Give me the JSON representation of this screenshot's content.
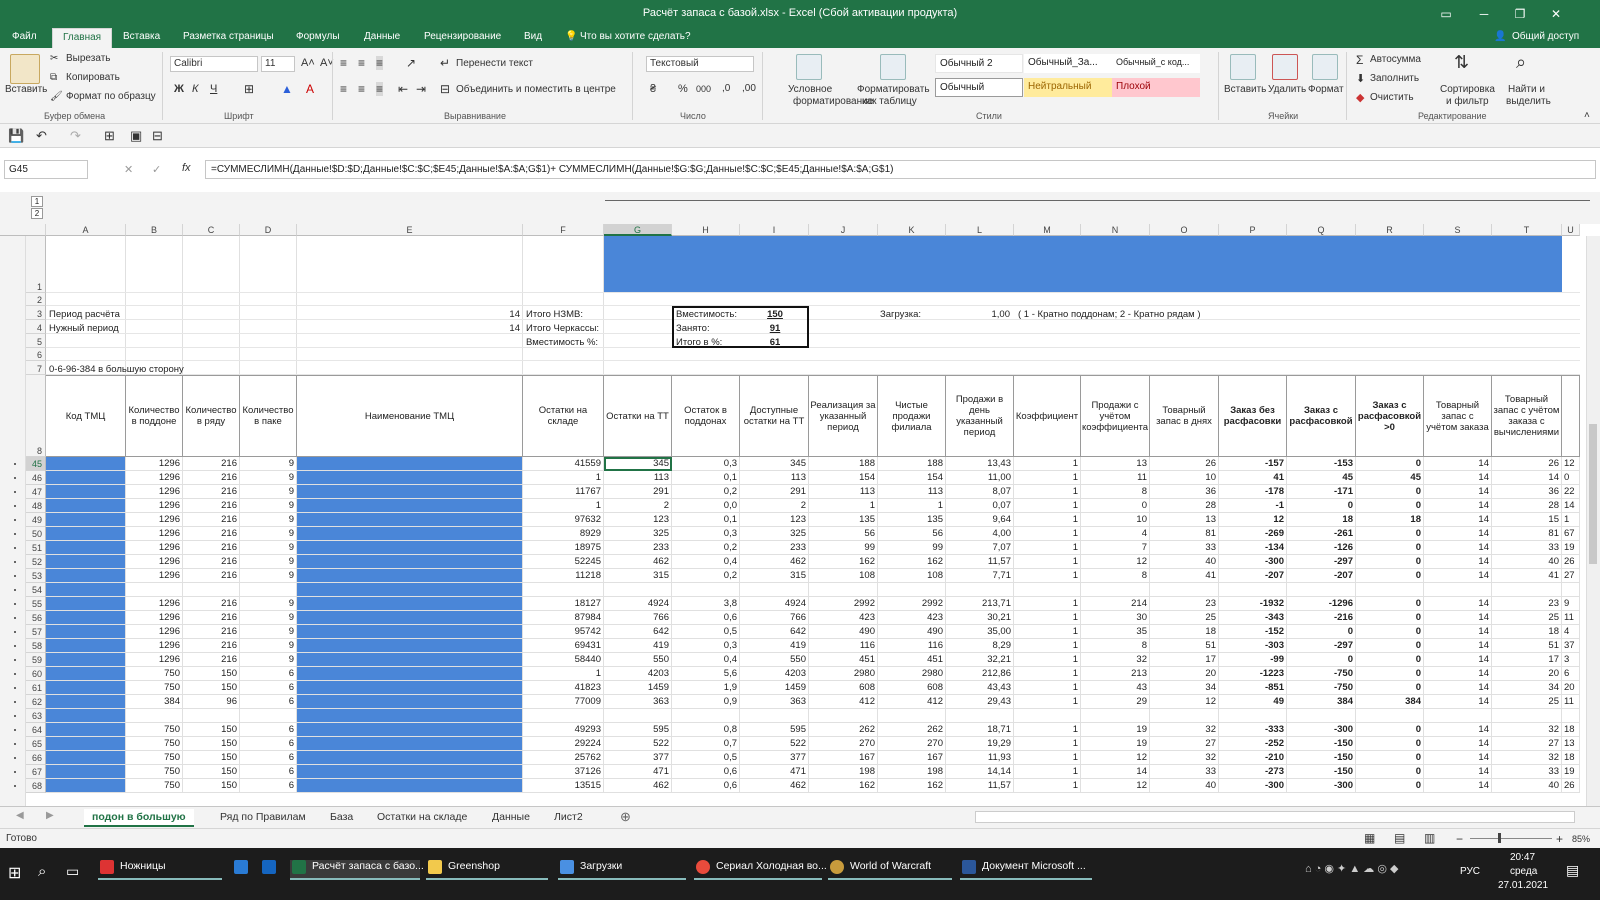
{
  "app": {
    "title": "Расчёт запаса с базой.xlsx - Excel (Сбой активации продукта)",
    "accent": "#217346"
  },
  "ribbon_tabs": [
    "Файл",
    "Главная",
    "Вставка",
    "Разметка страницы",
    "Формулы",
    "Данные",
    "Рецензирование",
    "Вид"
  ],
  "tellme": "Что вы хотите сделать?",
  "share": "Общий доступ",
  "ribbon": {
    "paste": "Вставить",
    "cut": "Вырезать",
    "copy": "Копировать",
    "format_painter": "Формат по образцу",
    "clipboard_group": "Буфер обмена",
    "font_name": "Calibri",
    "font_size": "11",
    "font_group": "Шрифт",
    "bold": "Ж",
    "italic": "К",
    "underline": "Ч",
    "wrap": "Перенести текст",
    "merge": "Объединить и поместить в центре",
    "align_group": "Выравнивание",
    "number_format": "Текстовый",
    "number_group": "Число",
    "percent": "%",
    "thousands": "000",
    "cond_format_1": "Условное",
    "cond_format_2": "форматирование",
    "format_table_1": "Форматировать",
    "format_table_2": "как таблицу",
    "styles": [
      "Обычный 2",
      "Обычный_За...",
      "Обычный_с код...",
      "Обычный",
      "Нейтральный",
      "Плохой"
    ],
    "styles_group": "Стили",
    "insert": "Вставить",
    "delete": "Удалить",
    "format": "Формат",
    "cells_group": "Ячейки",
    "autosum": "Автосумма",
    "fill": "Заполнить",
    "clear": "Очистить",
    "sort_1": "Сортировка",
    "sort_2": "и фильтр",
    "find_1": "Найти и",
    "find_2": "выделить",
    "edit_group": "Редактирование"
  },
  "formula_bar": {
    "name_box": "G45",
    "fx": "fx",
    "formula": "=СУММЕСЛИМН(Данные!$D:$D;Данные!$C:$C;$E45;Данные!$A:$A;G$1)+ СУММЕСЛИМН(Данные!$G:$G;Данные!$C:$C;$E45;Данные!$A:$A;G$1)"
  },
  "outline_levels": [
    "1",
    "2"
  ],
  "columns": [
    "A",
    "B",
    "C",
    "D",
    "E",
    "F",
    "G",
    "H",
    "I",
    "J",
    "K",
    "L",
    "M",
    "N",
    "O",
    "P",
    "Q",
    "R",
    "S",
    "T",
    "U"
  ],
  "top_rows": {
    "r3_label": "Период расчёта",
    "r3_val": "14",
    "r3_f": "Итого НЗМВ:",
    "r4_label": "Нужный период",
    "r4_val": "14",
    "r4_f": "Итого Черкассы:",
    "r5_f": "Вместимость %:",
    "r7_label": "0-6-96-384 в большую сторону",
    "box_cap_label": "Вместимость:",
    "box_cap_val": "150",
    "box_busy_label": "Занято:",
    "box_busy_val": "91",
    "box_pct_label": "Итого в %:",
    "box_pct_val": "61",
    "load_label": "Загрузка:",
    "load_val": "1,00",
    "load_note": "( 1 - Кратно поддонам; 2 - Кратно рядам )"
  },
  "table_headers": {
    "A": "Код ТМЦ",
    "B": "Количество в поддоне",
    "C": "Количество в ряду",
    "D": "Количество в паке",
    "E": "Наименование ТМЦ",
    "F": "Остатки на складе",
    "G": "Остатки на ТТ",
    "H": "Остаток в поддонах",
    "I": "Доступные остатки на ТТ",
    "J": "Реализация за указанный период",
    "K": "Чистые продажи филиала",
    "L": "Продажи в день указанный период",
    "M": "Коэффициент",
    "N": "Продажи с учётом коэффициента",
    "O": "Товарный запас в днях",
    "P": "Заказ без расфасовки",
    "Q": "Заказ с расфасовкой",
    "R": "Заказ с расфасовкой >0",
    "S": "Товарный запас с учётом заказа",
    "T": "Товарный запас с учётом заказа с вычислениями"
  },
  "data_rows": [
    {
      "n": "45",
      "B": "1296",
      "C": "216",
      "D": "9",
      "F": "41559",
      "G": "345",
      "H": "0,3",
      "I": "345",
      "J": "188",
      "K": "188",
      "L": "13,43",
      "M": "1",
      "N": "13",
      "O": "26",
      "P": "-157",
      "Q": "-153",
      "R": "0",
      "S": "14",
      "T": "26",
      "U": "12"
    },
    {
      "n": "46",
      "B": "1296",
      "C": "216",
      "D": "9",
      "F": "1",
      "G": "113",
      "H": "0,1",
      "I": "113",
      "J": "154",
      "K": "154",
      "L": "11,00",
      "M": "1",
      "N": "11",
      "O": "10",
      "P": "41",
      "Q": "45",
      "R": "45",
      "S": "14",
      "T": "14",
      "U": "0"
    },
    {
      "n": "47",
      "B": "1296",
      "C": "216",
      "D": "9",
      "F": "11767",
      "G": "291",
      "H": "0,2",
      "I": "291",
      "J": "113",
      "K": "113",
      "L": "8,07",
      "M": "1",
      "N": "8",
      "O": "36",
      "P": "-178",
      "Q": "-171",
      "R": "0",
      "S": "14",
      "T": "36",
      "U": "22"
    },
    {
      "n": "48",
      "B": "1296",
      "C": "216",
      "D": "9",
      "F": "1",
      "G": "2",
      "H": "0,0",
      "I": "2",
      "J": "1",
      "K": "1",
      "L": "0,07",
      "M": "1",
      "N": "0",
      "O": "28",
      "P": "-1",
      "Q": "0",
      "R": "0",
      "S": "14",
      "T": "28",
      "U": "14"
    },
    {
      "n": "49",
      "B": "1296",
      "C": "216",
      "D": "9",
      "F": "97632",
      "G": "123",
      "H": "0,1",
      "I": "123",
      "J": "135",
      "K": "135",
      "L": "9,64",
      "M": "1",
      "N": "10",
      "O": "13",
      "P": "12",
      "Q": "18",
      "R": "18",
      "S": "14",
      "T": "15",
      "U": "1"
    },
    {
      "n": "50",
      "B": "1296",
      "C": "216",
      "D": "9",
      "F": "8929",
      "G": "325",
      "H": "0,3",
      "I": "325",
      "J": "56",
      "K": "56",
      "L": "4,00",
      "M": "1",
      "N": "4",
      "O": "81",
      "P": "-269",
      "Q": "-261",
      "R": "0",
      "S": "14",
      "T": "81",
      "U": "67"
    },
    {
      "n": "51",
      "B": "1296",
      "C": "216",
      "D": "9",
      "F": "18975",
      "G": "233",
      "H": "0,2",
      "I": "233",
      "J": "99",
      "K": "99",
      "L": "7,07",
      "M": "1",
      "N": "7",
      "O": "33",
      "P": "-134",
      "Q": "-126",
      "R": "0",
      "S": "14",
      "T": "33",
      "U": "19"
    },
    {
      "n": "52",
      "B": "1296",
      "C": "216",
      "D": "9",
      "F": "52245",
      "G": "462",
      "H": "0,4",
      "I": "462",
      "J": "162",
      "K": "162",
      "L": "11,57",
      "M": "1",
      "N": "12",
      "O": "40",
      "P": "-300",
      "Q": "-297",
      "R": "0",
      "S": "14",
      "T": "40",
      "U": "26"
    },
    {
      "n": "53",
      "B": "1296",
      "C": "216",
      "D": "9",
      "F": "11218",
      "G": "315",
      "H": "0,2",
      "I": "315",
      "J": "108",
      "K": "108",
      "L": "7,71",
      "M": "1",
      "N": "8",
      "O": "41",
      "P": "-207",
      "Q": "-207",
      "R": "0",
      "S": "14",
      "T": "41",
      "U": "27"
    },
    {
      "n": "54",
      "B": "",
      "C": "",
      "D": "",
      "F": "",
      "G": "",
      "H": "",
      "I": "",
      "J": "",
      "K": "",
      "L": "",
      "M": "",
      "N": "",
      "O": "",
      "P": "",
      "Q": "",
      "R": "",
      "S": "",
      "T": "",
      "U": ""
    },
    {
      "n": "55",
      "B": "1296",
      "C": "216",
      "D": "9",
      "F": "18127",
      "G": "4924",
      "H": "3,8",
      "I": "4924",
      "J": "2992",
      "K": "2992",
      "L": "213,71",
      "M": "1",
      "N": "214",
      "O": "23",
      "P": "-1932",
      "Q": "-1296",
      "R": "0",
      "S": "14",
      "T": "23",
      "U": "9"
    },
    {
      "n": "56",
      "B": "1296",
      "C": "216",
      "D": "9",
      "F": "87984",
      "G": "766",
      "H": "0,6",
      "I": "766",
      "J": "423",
      "K": "423",
      "L": "30,21",
      "M": "1",
      "N": "30",
      "O": "25",
      "P": "-343",
      "Q": "-216",
      "R": "0",
      "S": "14",
      "T": "25",
      "U": "11"
    },
    {
      "n": "57",
      "B": "1296",
      "C": "216",
      "D": "9",
      "F": "95742",
      "G": "642",
      "H": "0,5",
      "I": "642",
      "J": "490",
      "K": "490",
      "L": "35,00",
      "M": "1",
      "N": "35",
      "O": "18",
      "P": "-152",
      "Q": "0",
      "R": "0",
      "S": "14",
      "T": "18",
      "U": "4"
    },
    {
      "n": "58",
      "B": "1296",
      "C": "216",
      "D": "9",
      "F": "69431",
      "G": "419",
      "H": "0,3",
      "I": "419",
      "J": "116",
      "K": "116",
      "L": "8,29",
      "M": "1",
      "N": "8",
      "O": "51",
      "P": "-303",
      "Q": "-297",
      "R": "0",
      "S": "14",
      "T": "51",
      "U": "37"
    },
    {
      "n": "59",
      "B": "1296",
      "C": "216",
      "D": "9",
      "F": "58440",
      "G": "550",
      "H": "0,4",
      "I": "550",
      "J": "451",
      "K": "451",
      "L": "32,21",
      "M": "1",
      "N": "32",
      "O": "17",
      "P": "-99",
      "Q": "0",
      "R": "0",
      "S": "14",
      "T": "17",
      "U": "3"
    },
    {
      "n": "60",
      "B": "750",
      "C": "150",
      "D": "6",
      "F": "1",
      "G": "4203",
      "H": "5,6",
      "I": "4203",
      "J": "2980",
      "K": "2980",
      "L": "212,86",
      "M": "1",
      "N": "213",
      "O": "20",
      "P": "-1223",
      "Q": "-750",
      "R": "0",
      "S": "14",
      "T": "20",
      "U": "6"
    },
    {
      "n": "61",
      "B": "750",
      "C": "150",
      "D": "6",
      "F": "41823",
      "G": "1459",
      "H": "1,9",
      "I": "1459",
      "J": "608",
      "K": "608",
      "L": "43,43",
      "M": "1",
      "N": "43",
      "O": "34",
      "P": "-851",
      "Q": "-750",
      "R": "0",
      "S": "14",
      "T": "34",
      "U": "20"
    },
    {
      "n": "62",
      "B": "384",
      "C": "96",
      "D": "6",
      "F": "77009",
      "G": "363",
      "H": "0,9",
      "I": "363",
      "J": "412",
      "K": "412",
      "L": "29,43",
      "M": "1",
      "N": "29",
      "O": "12",
      "P": "49",
      "Q": "384",
      "R": "384",
      "S": "14",
      "T": "25",
      "U": "11"
    },
    {
      "n": "63",
      "B": "",
      "C": "",
      "D": "",
      "F": "",
      "G": "",
      "H": "",
      "I": "",
      "J": "",
      "K": "",
      "L": "",
      "M": "",
      "N": "",
      "O": "",
      "P": "",
      "Q": "",
      "R": "",
      "S": "",
      "T": "",
      "U": ""
    },
    {
      "n": "64",
      "B": "750",
      "C": "150",
      "D": "6",
      "F": "49293",
      "G": "595",
      "H": "0,8",
      "I": "595",
      "J": "262",
      "K": "262",
      "L": "18,71",
      "M": "1",
      "N": "19",
      "O": "32",
      "P": "-333",
      "Q": "-300",
      "R": "0",
      "S": "14",
      "T": "32",
      "U": "18"
    },
    {
      "n": "65",
      "B": "750",
      "C": "150",
      "D": "6",
      "F": "29224",
      "G": "522",
      "H": "0,7",
      "I": "522",
      "J": "270",
      "K": "270",
      "L": "19,29",
      "M": "1",
      "N": "19",
      "O": "27",
      "P": "-252",
      "Q": "-150",
      "R": "0",
      "S": "14",
      "T": "27",
      "U": "13"
    },
    {
      "n": "66",
      "B": "750",
      "C": "150",
      "D": "6",
      "F": "25762",
      "G": "377",
      "H": "0,5",
      "I": "377",
      "J": "167",
      "K": "167",
      "L": "11,93",
      "M": "1",
      "N": "12",
      "O": "32",
      "P": "-210",
      "Q": "-150",
      "R": "0",
      "S": "14",
      "T": "32",
      "U": "18"
    },
    {
      "n": "67",
      "B": "750",
      "C": "150",
      "D": "6",
      "F": "37126",
      "G": "471",
      "H": "0,6",
      "I": "471",
      "J": "198",
      "K": "198",
      "L": "14,14",
      "M": "1",
      "N": "14",
      "O": "33",
      "P": "-273",
      "Q": "-150",
      "R": "0",
      "S": "14",
      "T": "33",
      "U": "19"
    },
    {
      "n": "68",
      "B": "750",
      "C": "150",
      "D": "6",
      "F": "13515",
      "G": "462",
      "H": "0,6",
      "I": "462",
      "J": "162",
      "K": "162",
      "L": "11,57",
      "M": "1",
      "N": "12",
      "O": "40",
      "P": "-300",
      "Q": "-300",
      "R": "0",
      "S": "14",
      "T": "40",
      "U": "26"
    }
  ],
  "sheets": [
    "подон в большую",
    "Ряд по Правилам",
    "База",
    "Остатки на складе",
    "Данные",
    "Лист2"
  ],
  "status": {
    "ready": "Готово",
    "zoom": "85%"
  },
  "taskbar": {
    "items": [
      "Ножницы",
      "",
      "",
      "Расчёт запаса с базо...",
      "Greenshop",
      "Загрузки",
      "Сериал Холодная во...",
      "World of Warcraft",
      "Документ Microsoft ..."
    ],
    "lang": "РУС",
    "time": "20:47",
    "day": "среда",
    "date": "27.01.2021"
  },
  "colors": {
    "fill_blue": "#4a86d8",
    "ribbon_green": "#217346",
    "neutral": "#ffeb9c",
    "bad": "#ffc7ce"
  }
}
